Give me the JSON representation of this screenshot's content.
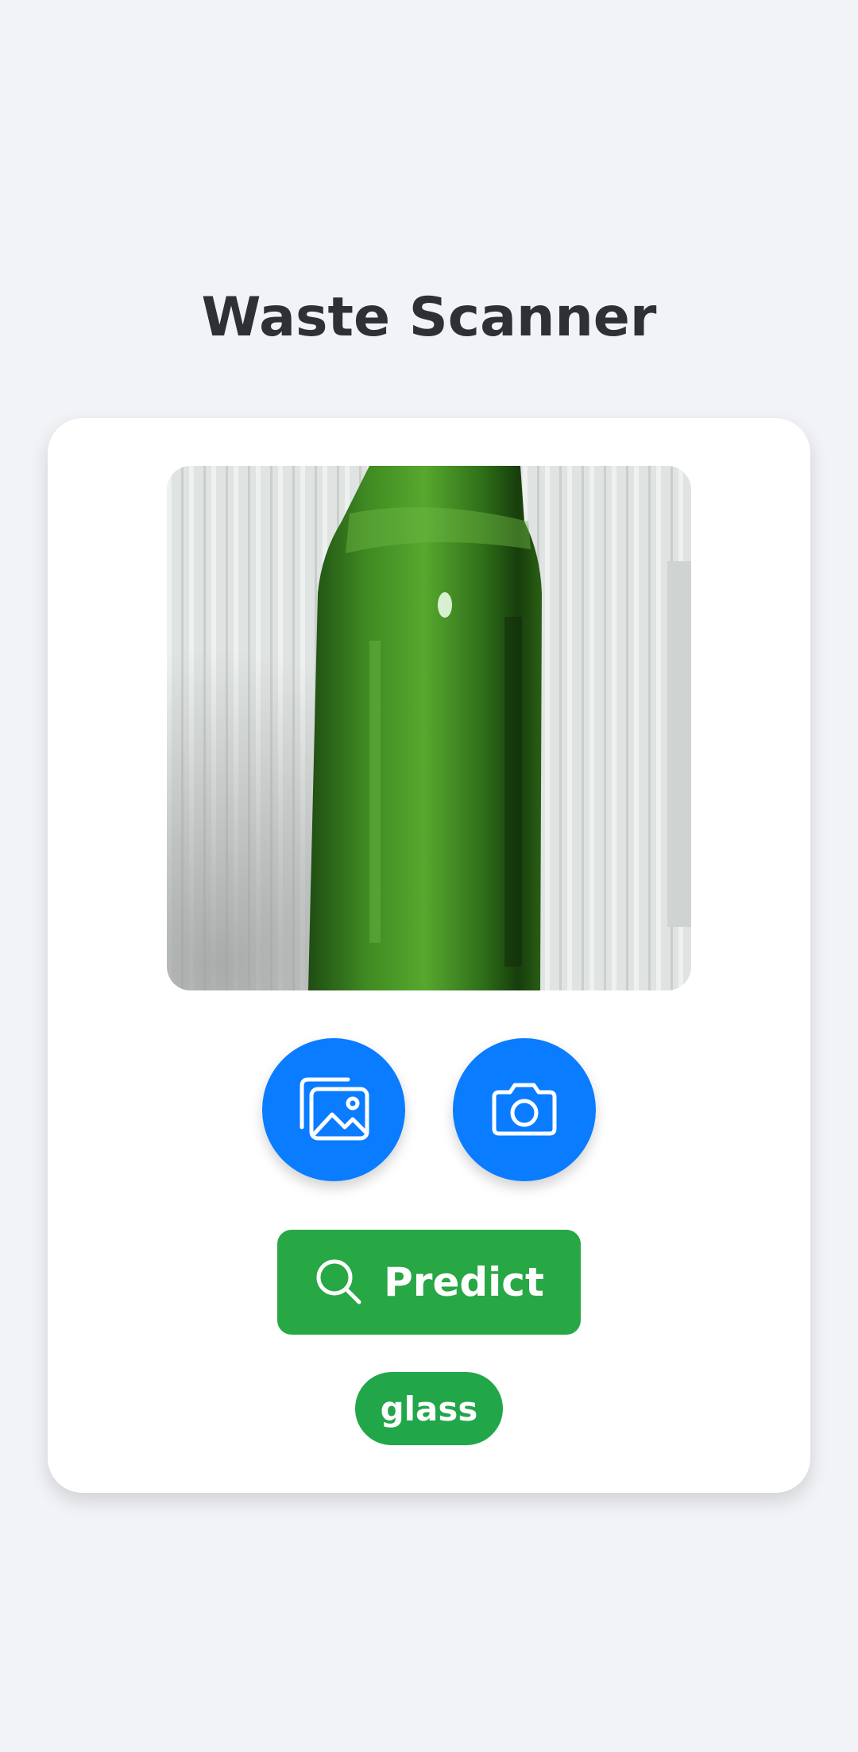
{
  "app": {
    "title": "Waste Scanner"
  },
  "preview": {
    "subject": "green glass bottle photo"
  },
  "buttons": {
    "gallery_icon": "gallery-icon",
    "camera_icon": "camera-icon",
    "predict_label": "Predict",
    "predict_icon": "search-icon"
  },
  "result": {
    "label": "glass"
  },
  "colors": {
    "background": "#f2f3f7",
    "primary_blue": "#0a7cff",
    "predict_green": "#28a745",
    "badge_green": "#22a64a",
    "title_text": "#2f3033"
  }
}
